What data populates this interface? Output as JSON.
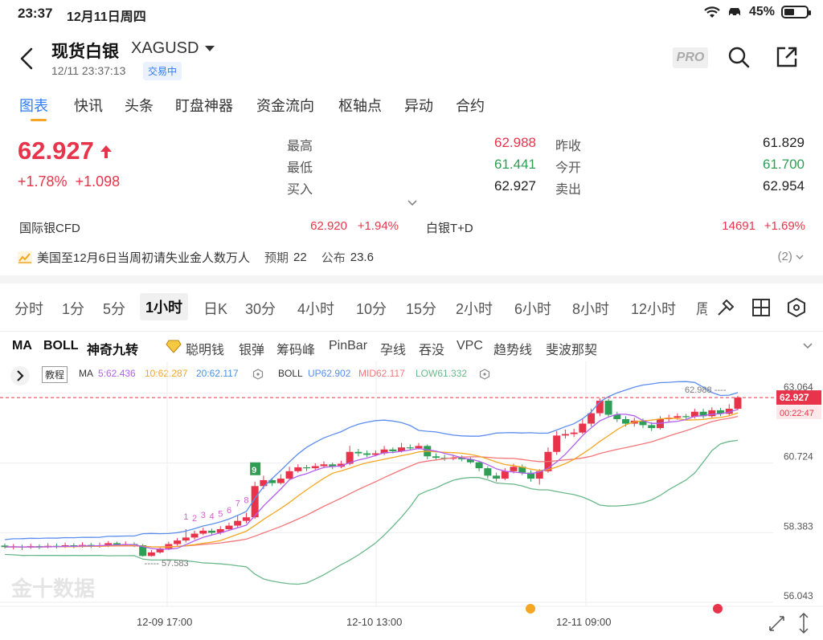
{
  "status_bar": {
    "time": "23:37",
    "date": "12月11日周四",
    "battery": "45%",
    "battery_level": 0.45
  },
  "header": {
    "title": "现货白银",
    "code": "XAGUSD",
    "timestamp": "12/11 23:37:13",
    "trade_status": "交易中",
    "pro_label": "PRO"
  },
  "tabs": [
    {
      "label": "图表"
    },
    {
      "label": "快讯"
    },
    {
      "label": "头条"
    },
    {
      "label": "盯盘神器"
    },
    {
      "label": "资金流向"
    },
    {
      "label": "枢轴点"
    },
    {
      "label": "异动"
    },
    {
      "label": "合约"
    }
  ],
  "quote": {
    "price": "62.927",
    "change_pct": "+1.78%",
    "change": "+1.098",
    "high_label": "最高",
    "high": "62.988",
    "low_label": "最低",
    "low": "61.441",
    "bid_label": "买入",
    "bid": "62.927",
    "prev_close_label": "昨收",
    "prev_close": "61.829",
    "open_label": "今开",
    "open": "61.700",
    "ask_label": "卖出",
    "ask": "62.954"
  },
  "related": {
    "cfd_label": "国际银CFD",
    "cfd_price": "62.920",
    "cfd_pct": "+1.94%",
    "td_label": "白银T+D",
    "td_price": "14691",
    "td_pct": "+1.69%"
  },
  "news": {
    "text": "美国至12月6日当周初请失业金人数万人",
    "expected_label": "预期",
    "expected": "22",
    "actual_label": "公布",
    "actual": "23.6",
    "count": "(2)"
  },
  "periods": [
    "分时",
    "1分",
    "5分",
    "1小时",
    "日K",
    "30分",
    "4小时",
    "10分",
    "15分",
    "2小时",
    "6小时",
    "8小时",
    "12小时",
    "周"
  ],
  "indicators": [
    "MA",
    "BOLL",
    "神奇九转",
    "聪明钱",
    "银弹",
    "筹码峰",
    "PinBar",
    "孕线",
    "吞没",
    "VPC",
    "趋势线",
    "斐波那契"
  ],
  "legend": {
    "tutorial": "教程",
    "ma_label": "MA",
    "ma5": "5:62.436",
    "ma10": "10:62.287",
    "ma20": "20:62.117",
    "boll_label": "BOLL",
    "boll_up": "UP62.902",
    "boll_mid": "MID62.117",
    "boll_low": "LOW61.332"
  },
  "colors": {
    "up": "#e8344b",
    "down": "#2e9e55",
    "accent": "#2f7cf6",
    "ma5": "#b05ff0",
    "ma10": "#f5a623",
    "ma20": "#4a90e2",
    "boll_up": "#5b8def",
    "boll_mid": "#f2777a",
    "boll_low": "#6ab88a"
  },
  "chart_data": {
    "type": "candlestick",
    "y_ticks": [
      "63.064",
      "60.724",
      "58.383",
      "56.043"
    ],
    "ylim": [
      56.043,
      63.064
    ],
    "x_labels": [
      "12-09 17:00",
      "12-10 13:00",
      "12-11 09:00"
    ],
    "current_price_tag": "62.927",
    "countdown": "00:22:47",
    "high_marker": "62.988",
    "low_marker": "57.583",
    "nine_turn_labels": [
      "1",
      "2",
      "3",
      "4",
      "5",
      "6",
      "7",
      "8",
      "9"
    ],
    "watermark": "金十数据",
    "candles": [
      [
        57.95,
        57.9,
        58.02,
        57.85
      ],
      [
        57.9,
        57.92,
        58.0,
        57.82
      ],
      [
        57.92,
        57.88,
        57.98,
        57.8
      ],
      [
        57.88,
        57.93,
        58.01,
        57.84
      ],
      [
        57.93,
        57.89,
        57.99,
        57.83
      ],
      [
        57.89,
        57.94,
        58.03,
        57.86
      ],
      [
        57.94,
        57.9,
        58.02,
        57.85
      ],
      [
        57.9,
        57.96,
        58.05,
        57.87
      ],
      [
        57.96,
        57.92,
        58.03,
        57.86
      ],
      [
        57.92,
        57.97,
        58.06,
        57.88
      ],
      [
        57.97,
        57.93,
        58.04,
        57.87
      ],
      [
        57.93,
        57.95,
        58.05,
        57.88
      ],
      [
        57.95,
        58.03,
        58.1,
        57.9
      ],
      [
        58.03,
        57.98,
        58.08,
        57.92
      ],
      [
        57.98,
        58.0,
        58.09,
        57.93
      ],
      [
        58.0,
        57.96,
        58.06,
        57.9
      ],
      [
        57.96,
        57.6,
        58.0,
        57.58
      ],
      [
        57.6,
        57.72,
        57.8,
        57.58
      ],
      [
        57.72,
        57.85,
        57.92,
        57.68
      ],
      [
        57.85,
        58.0,
        58.08,
        57.8
      ],
      [
        58.0,
        58.12,
        58.2,
        57.95
      ],
      [
        58.12,
        58.22,
        58.5,
        58.05
      ],
      [
        58.22,
        58.35,
        58.45,
        58.15
      ],
      [
        58.35,
        58.45,
        58.55,
        58.3
      ],
      [
        58.45,
        58.38,
        58.52,
        58.3
      ],
      [
        58.38,
        58.5,
        58.6,
        58.32
      ],
      [
        58.5,
        58.62,
        58.72,
        58.45
      ],
      [
        58.62,
        58.78,
        58.95,
        58.55
      ],
      [
        58.78,
        58.9,
        59.05,
        58.7
      ],
      [
        58.9,
        59.95,
        60.1,
        58.85
      ],
      [
        59.95,
        60.15,
        60.3,
        59.85
      ],
      [
        60.15,
        60.05,
        60.22,
        59.95
      ],
      [
        60.05,
        60.2,
        60.35,
        60.0
      ],
      [
        60.2,
        60.45,
        60.6,
        60.15
      ],
      [
        60.45,
        60.58,
        60.68,
        60.4
      ],
      [
        60.58,
        60.55,
        60.66,
        60.45
      ],
      [
        60.55,
        60.62,
        60.72,
        60.48
      ],
      [
        60.62,
        60.68,
        60.78,
        60.55
      ],
      [
        60.68,
        60.6,
        60.74,
        60.52
      ],
      [
        60.6,
        60.7,
        60.8,
        60.55
      ],
      [
        60.7,
        61.1,
        61.3,
        60.65
      ],
      [
        61.1,
        61.05,
        61.2,
        60.95
      ],
      [
        61.05,
        61.0,
        61.15,
        60.92
      ],
      [
        61.0,
        61.05,
        61.15,
        60.95
      ],
      [
        61.05,
        61.18,
        61.3,
        61.0
      ],
      [
        61.18,
        61.12,
        61.25,
        61.05
      ],
      [
        61.12,
        61.25,
        61.4,
        61.08
      ],
      [
        61.25,
        61.22,
        61.35,
        61.15
      ],
      [
        61.22,
        61.3,
        61.4,
        61.18
      ],
      [
        61.3,
        60.95,
        61.35,
        60.85
      ],
      [
        60.95,
        60.9,
        61.05,
        60.82
      ],
      [
        60.9,
        60.88,
        61.0,
        60.8
      ],
      [
        60.88,
        60.9,
        61.0,
        60.82
      ],
      [
        60.9,
        60.85,
        60.98,
        60.78
      ],
      [
        60.85,
        60.75,
        60.92,
        60.7
      ],
      [
        60.75,
        60.55,
        60.8,
        60.45
      ],
      [
        60.55,
        60.3,
        60.62,
        60.2
      ],
      [
        60.3,
        60.2,
        60.4,
        60.1
      ],
      [
        60.2,
        60.45,
        60.55,
        60.15
      ],
      [
        60.45,
        60.6,
        60.7,
        60.38
      ],
      [
        60.6,
        60.4,
        60.68,
        60.32
      ],
      [
        60.4,
        60.2,
        60.48,
        60.1
      ],
      [
        60.2,
        60.45,
        60.52,
        60.0
      ],
      [
        60.45,
        61.1,
        61.25,
        60.4
      ],
      [
        61.1,
        61.65,
        61.8,
        61.0
      ],
      [
        61.65,
        61.7,
        61.85,
        61.55
      ],
      [
        61.7,
        61.75,
        61.88,
        61.6
      ],
      [
        61.75,
        62.05,
        62.2,
        61.7
      ],
      [
        62.05,
        62.4,
        62.55,
        61.95
      ],
      [
        62.4,
        62.82,
        62.9,
        62.3
      ],
      [
        62.82,
        62.35,
        62.88,
        62.25
      ],
      [
        62.35,
        62.2,
        62.45,
        62.1
      ],
      [
        62.2,
        62.05,
        62.3,
        61.95
      ],
      [
        62.05,
        62.15,
        62.25,
        61.95
      ],
      [
        62.15,
        62.0,
        62.22,
        61.9
      ],
      [
        62.0,
        61.9,
        62.1,
        61.8
      ],
      [
        61.9,
        62.2,
        62.3,
        61.85
      ],
      [
        62.2,
        62.25,
        62.35,
        62.12
      ],
      [
        62.25,
        62.3,
        62.4,
        62.18
      ],
      [
        62.3,
        62.28,
        62.38,
        62.2
      ],
      [
        62.28,
        62.45,
        62.55,
        62.22
      ],
      [
        62.45,
        62.3,
        62.55,
        62.22
      ],
      [
        62.3,
        62.5,
        62.6,
        62.25
      ],
      [
        62.5,
        62.38,
        62.58,
        62.3
      ],
      [
        62.38,
        62.55,
        62.7,
        62.3
      ],
      [
        62.55,
        62.927,
        62.988,
        62.5
      ]
    ]
  }
}
